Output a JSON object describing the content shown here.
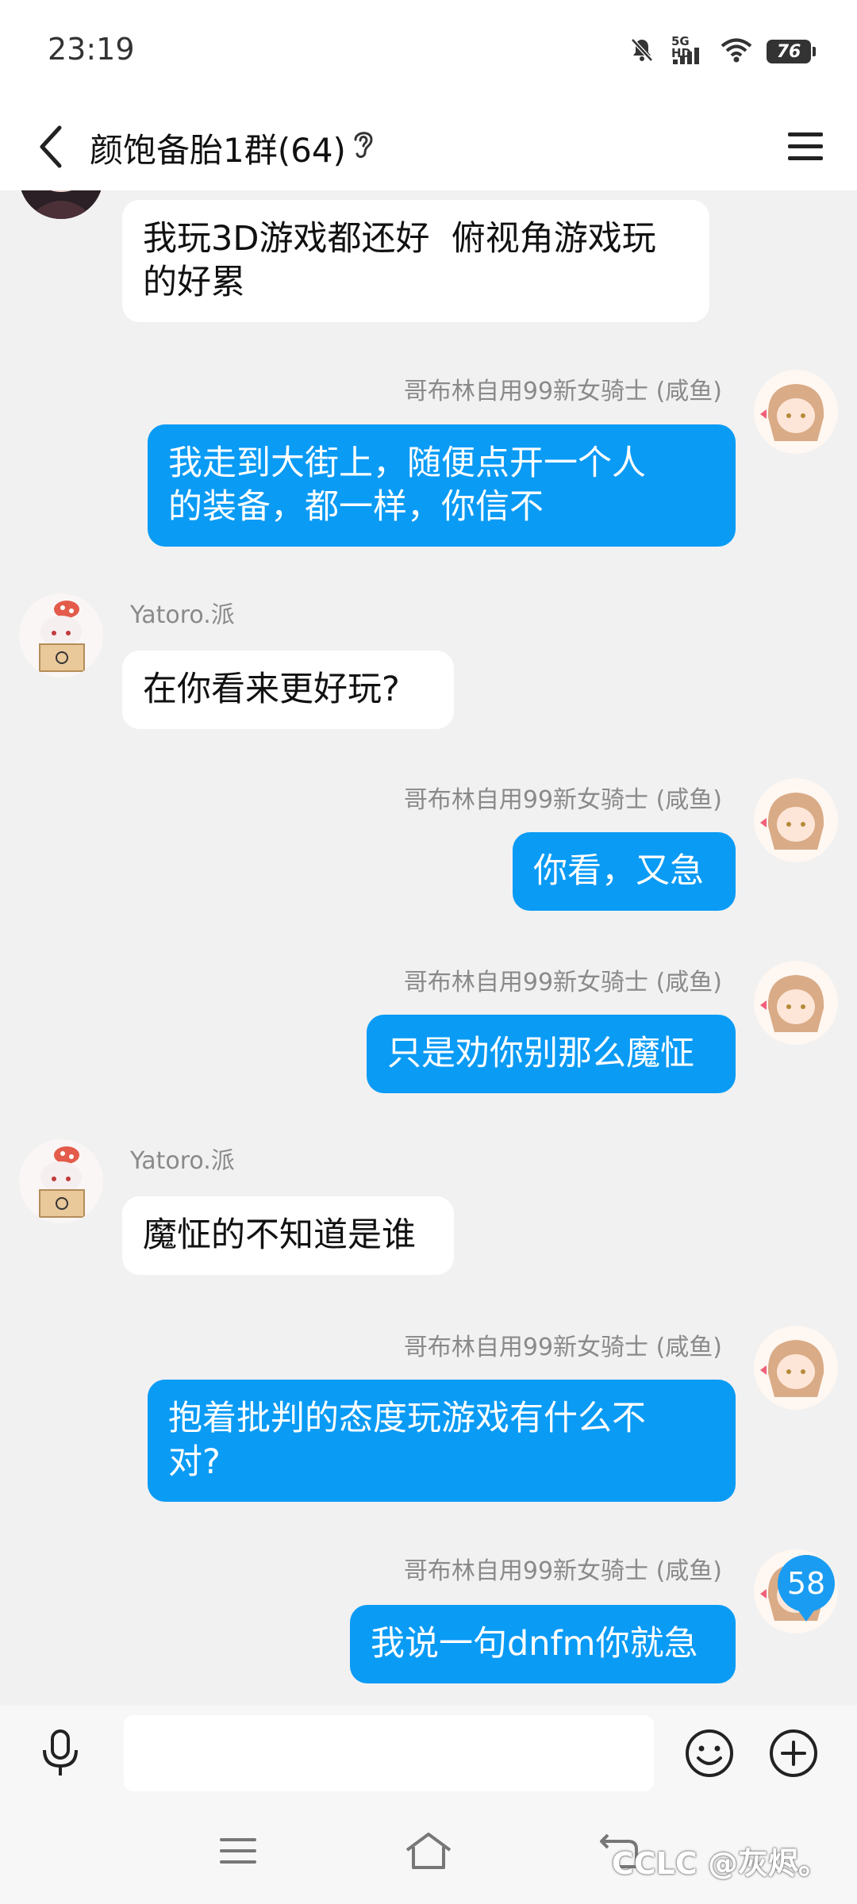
{
  "status_bar": {
    "time": "23:19",
    "network_label": "5G HD",
    "battery_level": "76"
  },
  "header": {
    "title": "颜饱备胎1群(64)"
  },
  "messages": [
    {
      "side": "in",
      "sender": "",
      "text": "我玩3D游戏都还好  俯视角游戏玩\n的好累"
    },
    {
      "side": "out",
      "sender": "哥布林自用99新女骑士 (咸鱼)",
      "text": "我走到大街上，随便点开一个人\n的装备，都一样，你信不"
    },
    {
      "side": "in",
      "sender": "Yatoro.派",
      "text": "在你看来更好玩?"
    },
    {
      "side": "out",
      "sender": "哥布林自用99新女骑士 (咸鱼)",
      "text": "你看，又急"
    },
    {
      "side": "out",
      "sender": "哥布林自用99新女骑士 (咸鱼)",
      "text": "只是劝你别那么魔怔"
    },
    {
      "side": "in",
      "sender": "Yatoro.派",
      "text": "魔怔的不知道是谁"
    },
    {
      "side": "out",
      "sender": "哥布林自用99新女骑士 (咸鱼)",
      "text": "抱着批判的态度玩游戏有什么不\n对?"
    },
    {
      "side": "out",
      "sender": "哥布林自用99新女骑士 (咸鱼)",
      "text": "我说一句dnfm你就急"
    }
  ],
  "unread_count": "58",
  "input": {
    "value": "",
    "placeholder": ""
  },
  "watermark": "CCLC @灰烬。",
  "colors": {
    "outgoing_bubble": "#0a9bf5",
    "incoming_bubble": "#ffffff",
    "chat_background": "#f1f1f1",
    "badge": "#1a9cf2"
  },
  "icons": {
    "back": "chevron-left-icon",
    "ear": "ear-icon",
    "menu": "hamburger-menu-icon",
    "mic": "microphone-icon",
    "emoji": "smiley-icon",
    "plus": "plus-circle-icon",
    "nav_menu": "nav-menu-icon",
    "nav_home": "nav-home-icon",
    "nav_back": "nav-back-icon"
  }
}
